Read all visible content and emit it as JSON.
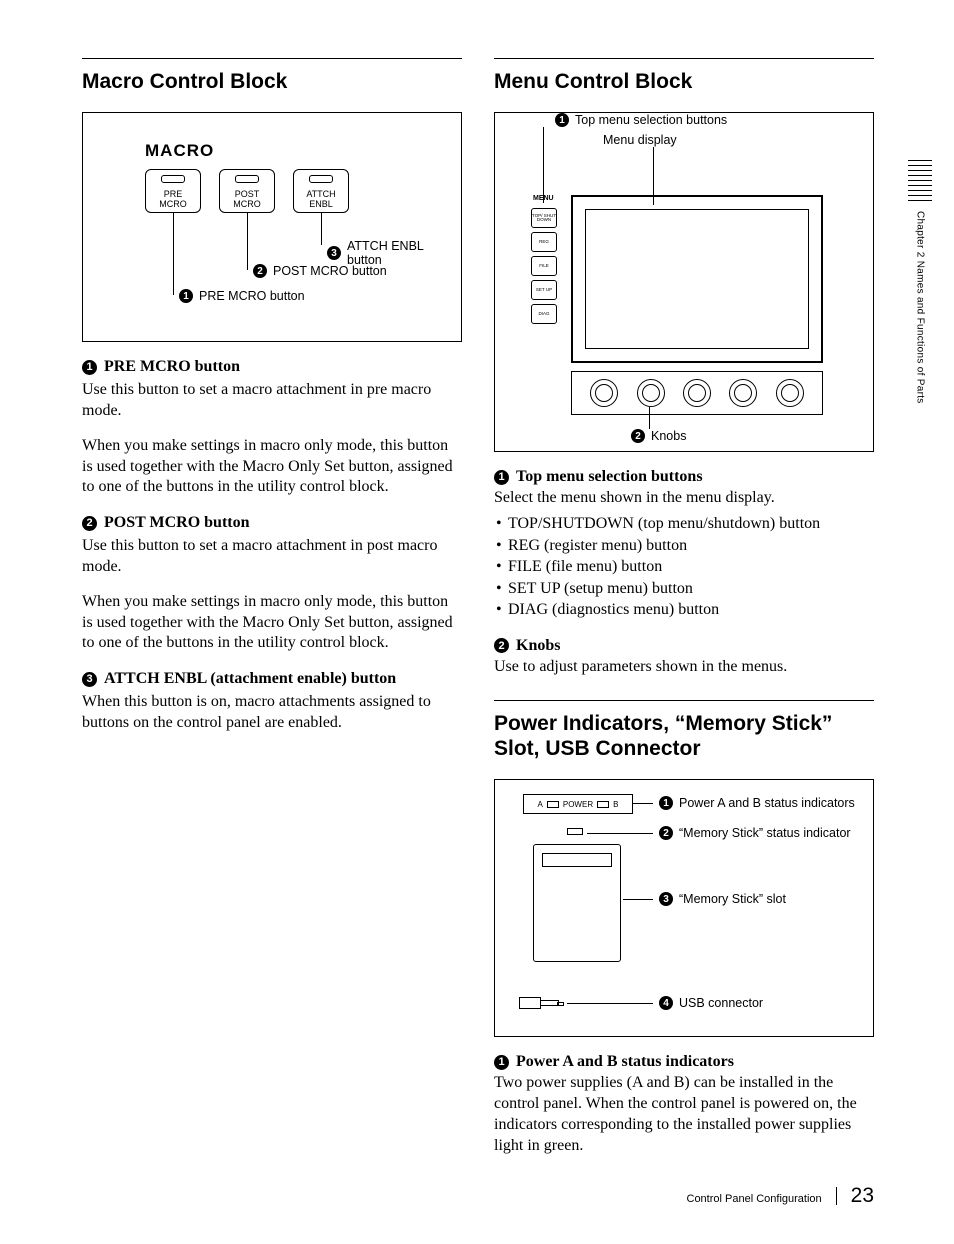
{
  "margin": {
    "chapter": "Chapter 2  Names and Functions of Parts"
  },
  "footer": {
    "section": "Control Panel Configuration",
    "page": "23"
  },
  "left": {
    "title": "Macro Control Block",
    "fig": {
      "heading": "MACRO",
      "buttons": [
        {
          "line1": "PRE",
          "line2": "MCRO"
        },
        {
          "line1": "POST",
          "line2": "MCRO"
        },
        {
          "line1": "ATTCH",
          "line2": "ENBL"
        }
      ],
      "callouts": {
        "c3": "ATTCH ENBL button",
        "c2": "POST MCRO button",
        "c1": "PRE MCRO button"
      }
    },
    "items": [
      {
        "num": "1",
        "title": "PRE MCRO button",
        "paras": [
          "Use this button to set a macro attachment in pre macro mode.",
          "When you make settings in macro only mode, this button is used together with the Macro Only Set button, assigned to one of the buttons in the utility control block."
        ]
      },
      {
        "num": "2",
        "title": "POST MCRO button",
        "paras": [
          "Use this button to set a macro attachment in post macro mode.",
          "When you make settings in macro only mode, this button is used together with the Macro Only Set button, assigned to one of the buttons in the utility control block."
        ]
      },
      {
        "num": "3",
        "title": "ATTCH ENBL (attachment enable) button",
        "paras": [
          "When this button is on, macro attachments assigned to buttons on the control panel are enabled."
        ]
      }
    ]
  },
  "right": {
    "menu": {
      "title": "Menu Control Block",
      "fig": {
        "c1": "Top menu selection buttons",
        "disp": "Menu display",
        "c2": "Knobs",
        "menuLabel": "MENU",
        "btns": [
          "TOP/\nSHUT\nDOWN",
          "REG",
          "FILE",
          "SET\nUP",
          "DIAG"
        ]
      },
      "items": [
        {
          "num": "1",
          "title": "Top menu selection buttons",
          "lead": "Select the menu shown in the menu display.",
          "bullets": [
            "TOP/SHUTDOWN (top menu/shutdown) button",
            "REG (register menu) button",
            "FILE (file menu) button",
            "SET UP (setup menu) button",
            "DIAG (diagnostics menu) button"
          ]
        },
        {
          "num": "2",
          "title": "Knobs",
          "lead": "Use to adjust parameters shown in the menus."
        }
      ]
    },
    "power": {
      "title": "Power Indicators, “Memory Stick” Slot, USB Connector",
      "fig": {
        "topA": "A",
        "topLabel": "POWER",
        "topB": "B",
        "c1": "Power A and B status indicators",
        "c2": "“Memory Stick” status indicator",
        "c3": "“Memory Stick” slot",
        "c4": "USB connector"
      },
      "items": [
        {
          "num": "1",
          "title": "Power A and B status indicators",
          "lead": "Two power supplies (A and B) can be installed in the control panel. When the control panel is powered on, the indicators corresponding to the installed power supplies light in green."
        }
      ]
    }
  }
}
